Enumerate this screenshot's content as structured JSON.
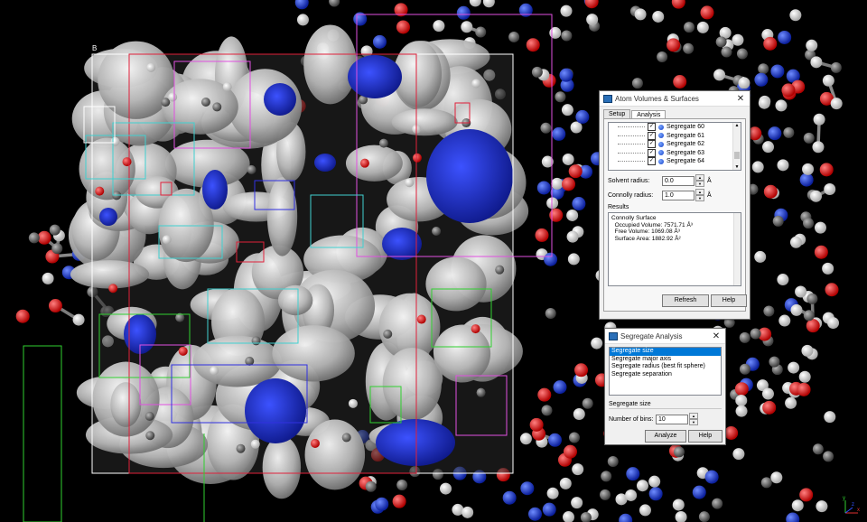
{
  "viewport": {
    "label": "molecular-viewer-3d-view",
    "box_corner_label": "B"
  },
  "dialog_volumes": {
    "title": "Atom Volumes & Surfaces",
    "close_glyph": "✕",
    "tabs": [
      {
        "label": "Setup",
        "active": false
      },
      {
        "label": "Analysis",
        "active": true
      }
    ],
    "segregates": [
      {
        "label": "Segregate 60",
        "checked": true
      },
      {
        "label": "Segregate 61",
        "checked": true
      },
      {
        "label": "Segregate 62",
        "checked": true
      },
      {
        "label": "Segregate 63",
        "checked": true
      },
      {
        "label": "Segregate 64",
        "checked": true
      }
    ],
    "solvent_radius": {
      "label": "Solvent radius:",
      "value": "0.0",
      "unit": "Å"
    },
    "connolly_radius": {
      "label": "Connolly radius:",
      "value": "1.0",
      "unit": "Å"
    },
    "results_label": "Results",
    "results_lines": [
      "Connolly Surface",
      "  Occupied Volume: 7571.71 Å³",
      "  Free Volume: 1069.08 Å³",
      "  Surface Area: 1882.92 Å²"
    ],
    "refresh_label": "Refresh",
    "help_label": "Help"
  },
  "dialog_segregate": {
    "title": "Segregate Analysis",
    "close_glyph": "✕",
    "options": [
      {
        "label": "Segregate size",
        "selected": true
      },
      {
        "label": "Segregate major axis",
        "selected": false
      },
      {
        "label": "Segregate radius (best fit sphere)",
        "selected": false
      },
      {
        "label": "Segregate separation",
        "selected": false
      }
    ],
    "section_label": "Segregate size",
    "bins_label": "Number of bins:",
    "bins_value": "10",
    "analyze_label": "Analyze",
    "help_label": "Help"
  },
  "axes": {
    "x": "x",
    "y": "y",
    "z": "z"
  },
  "colors": {
    "surface": "#bdbdbd",
    "cavity": "#1b2cd6",
    "oxygen": "#d41010",
    "carbon": "#7a7a7a",
    "hydrogen": "#eeeeee",
    "nitrogen": "#1a3fd0",
    "box_white": "#ffffff",
    "box_red": "#e0203a",
    "box_magenta": "#e050e0",
    "box_cyan": "#40d0d0",
    "box_green": "#30d030",
    "box_blue": "#3030e0"
  }
}
